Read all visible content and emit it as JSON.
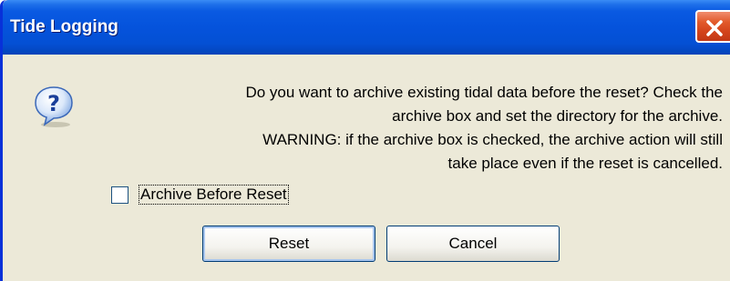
{
  "window": {
    "title": "Tide Logging",
    "close_icon": "close-icon",
    "accent_color": "#0553dc"
  },
  "dialog": {
    "icon": "question-icon",
    "message_lines": [
      "Do you want to archive existing tidal data before the reset? Check the",
      "archive box and set the directory for the archive.",
      "WARNING: if the archive box is checked, the archive action will still",
      "take place even if the reset is cancelled."
    ],
    "checkbox": {
      "label": "Archive Before Reset",
      "checked": false
    },
    "buttons": {
      "reset_label": "Reset",
      "cancel_label": "Cancel"
    }
  }
}
